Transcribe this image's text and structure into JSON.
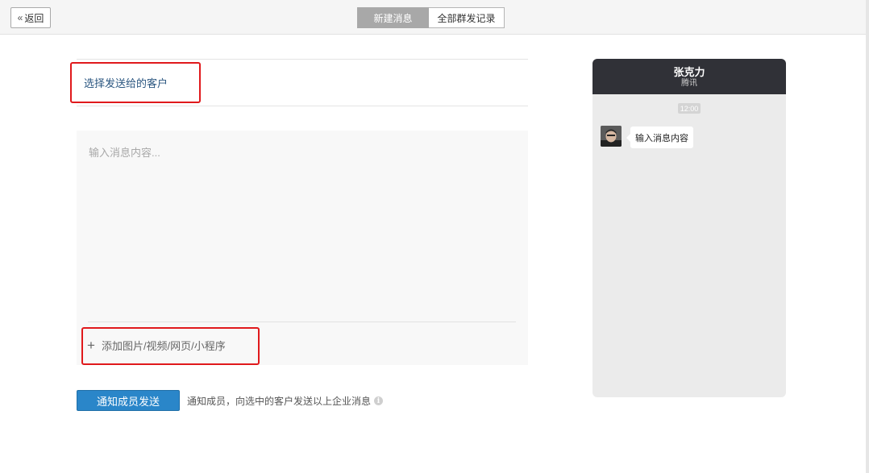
{
  "toolbar": {
    "back_label": "返回",
    "tabs": [
      {
        "label": "新建消息",
        "active": true
      },
      {
        "label": "全部群发记录",
        "active": false
      }
    ]
  },
  "form": {
    "select_customer_label": "选择发送给的客户",
    "message_placeholder": "输入消息内容...",
    "attach_label": "添加图片/视频/网页/小程序",
    "send_button_label": "通知成员发送",
    "send_hint": "通知成员，向选中的客户发送以上企业消息"
  },
  "preview": {
    "sender_name": "张克力",
    "sender_company": "腾讯",
    "time": "12:00",
    "message_text": "输入消息内容"
  },
  "colors": {
    "highlight_box": "#e0191c",
    "primary_button": "#2a86c9",
    "phone_header": "#303137",
    "link_text": "#2a5680"
  }
}
